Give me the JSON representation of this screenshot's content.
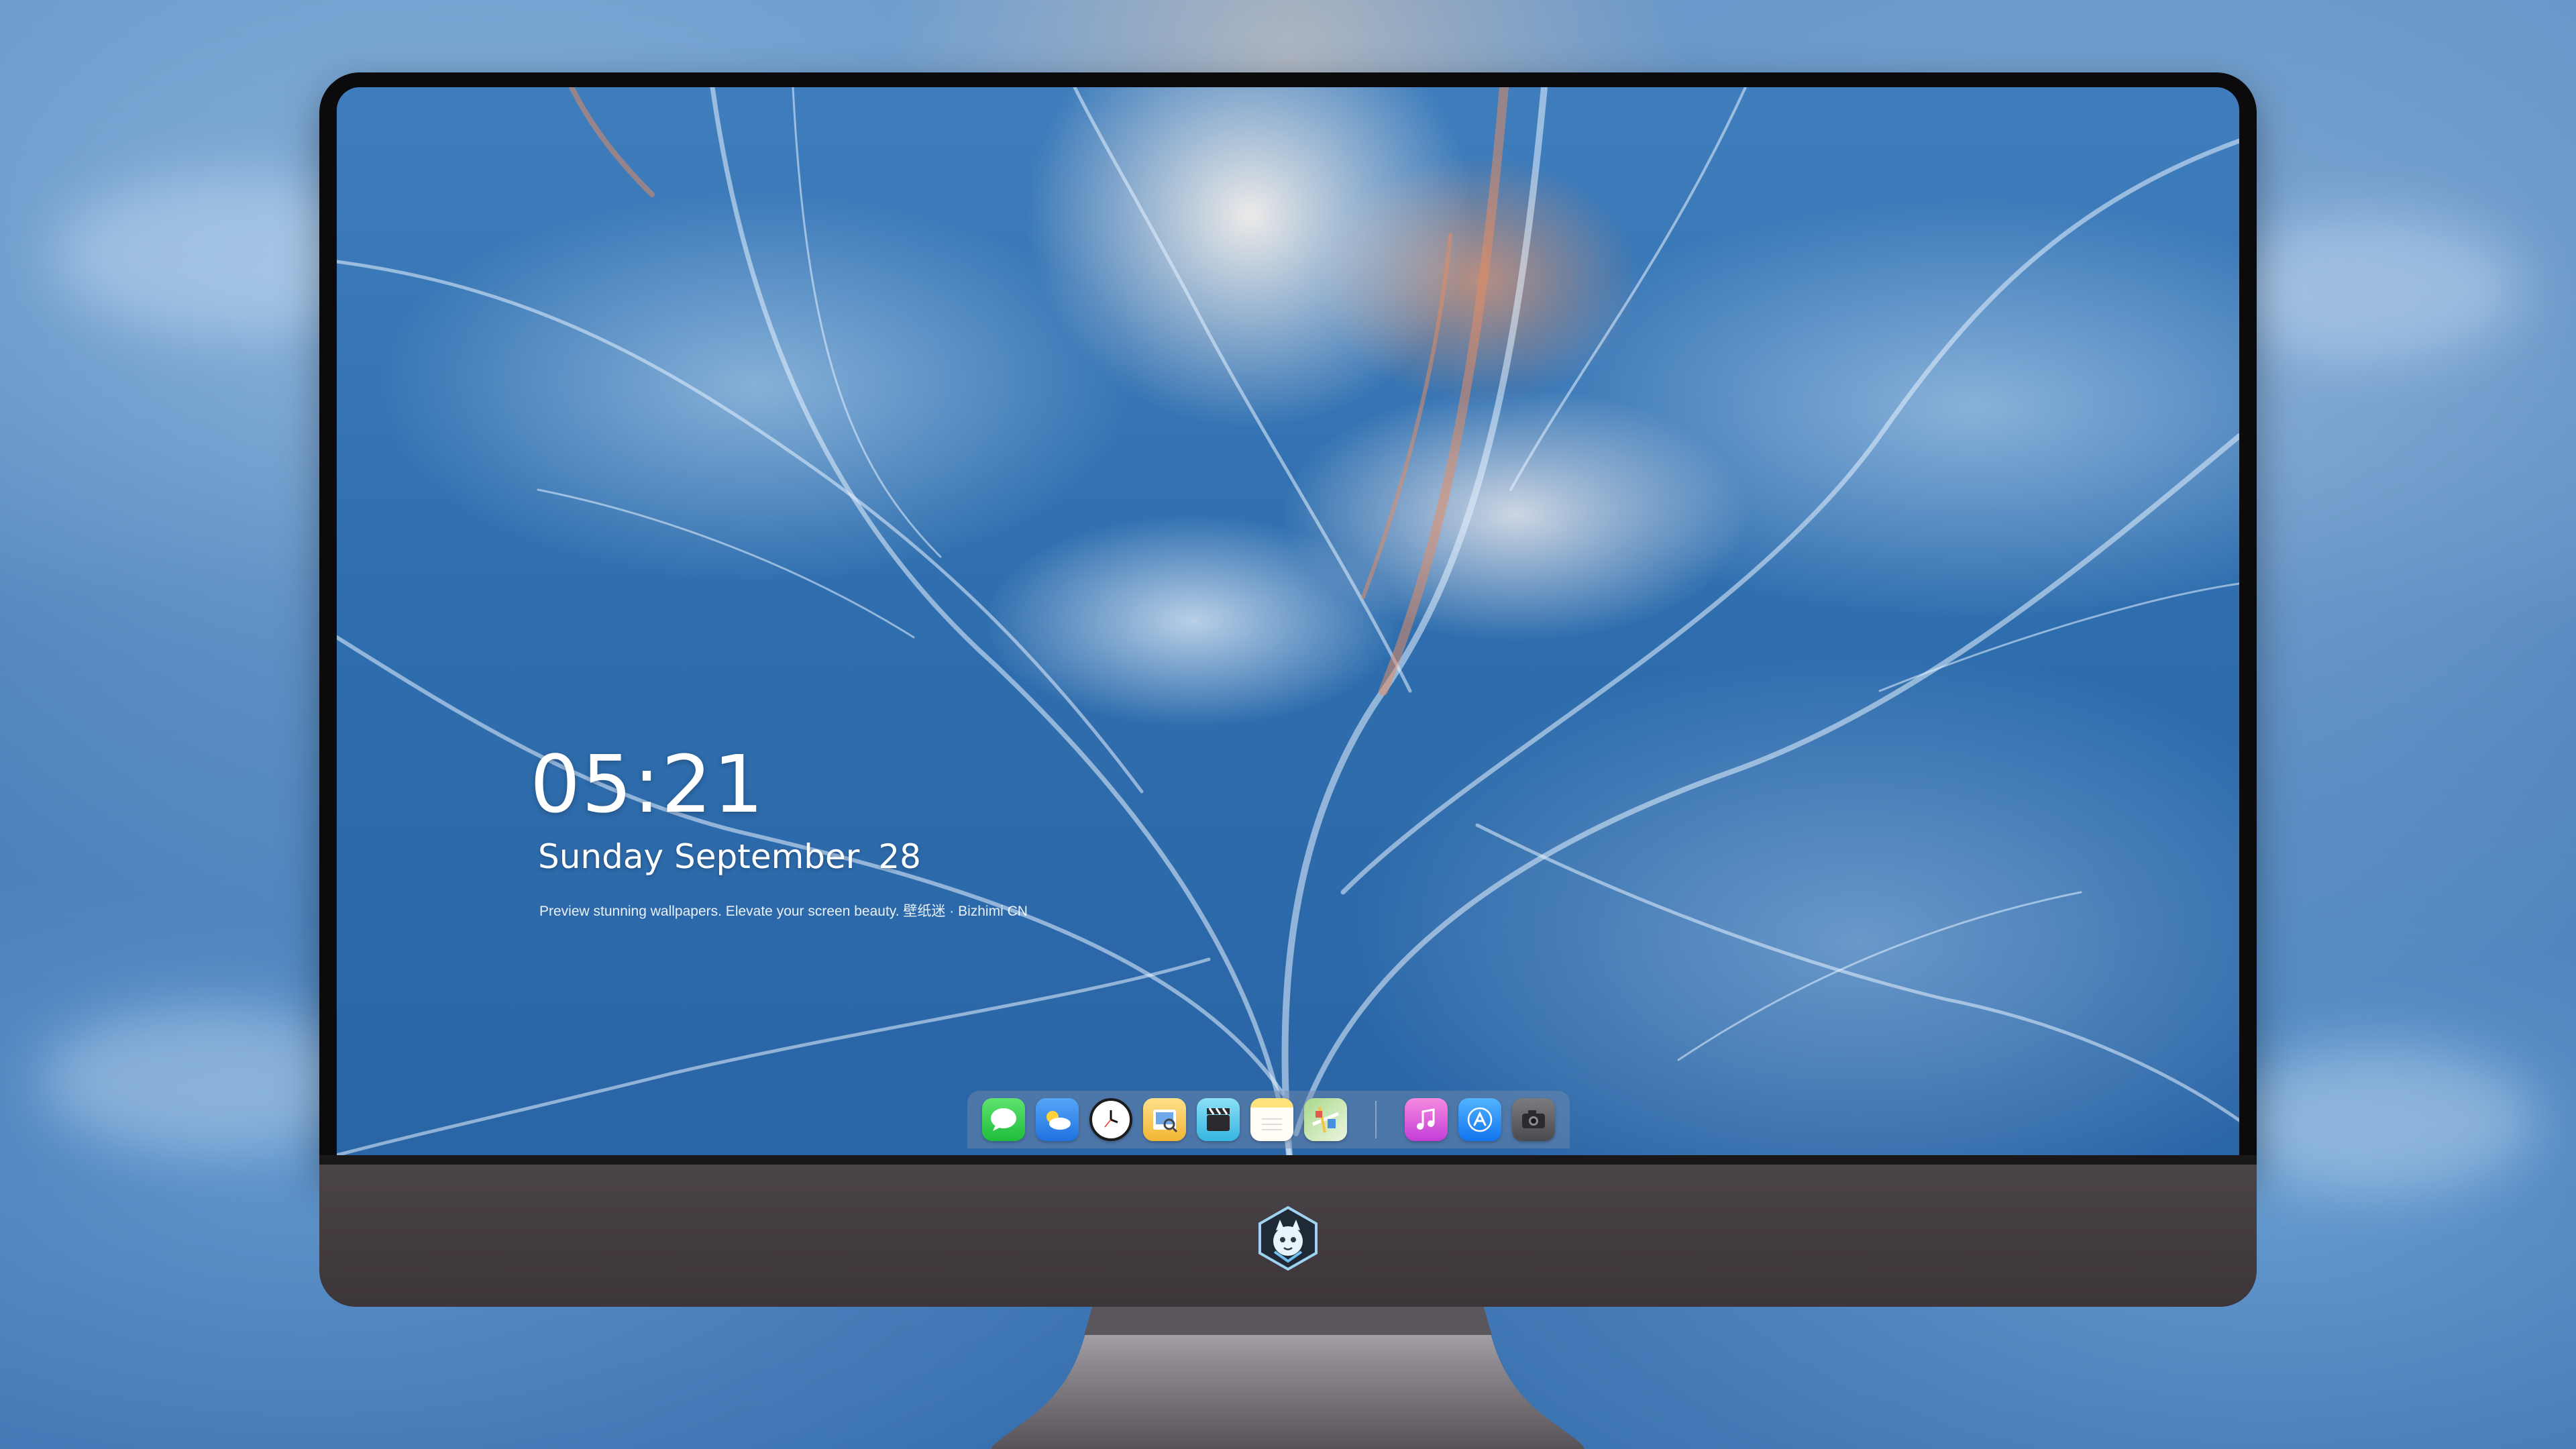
{
  "lockscreen": {
    "time": "05:21",
    "weekday_month": "Sunday September",
    "day": "28",
    "caption": "Preview stunning wallpapers. Elevate your screen beauty. 壁纸迷 · Bizhimi CN"
  },
  "dock": {
    "apps": [
      {
        "name": "messages-icon",
        "color": "#2fcf4c"
      },
      {
        "name": "weather-icon",
        "color": "#3b8df0"
      },
      {
        "name": "clock-icon",
        "color": "#1c1c1e"
      },
      {
        "name": "preview-icon",
        "color": "#f2b632"
      },
      {
        "name": "clips-icon",
        "color": "#4fc7e8"
      },
      {
        "name": "notes-icon",
        "color": "#ffd54a"
      },
      {
        "name": "maps-icon",
        "color": "#6fbf5a"
      },
      {
        "name": "itunes-icon",
        "color": "#e34ec9"
      },
      {
        "name": "app-store-icon",
        "color": "#1e8ef7"
      },
      {
        "name": "camera-icon",
        "color": "#5c5c60"
      }
    ]
  },
  "monitor": {
    "bezel_color": "#0b0b0d",
    "chin_color": "#443d41",
    "logo_name": "mascot-logo-icon"
  }
}
